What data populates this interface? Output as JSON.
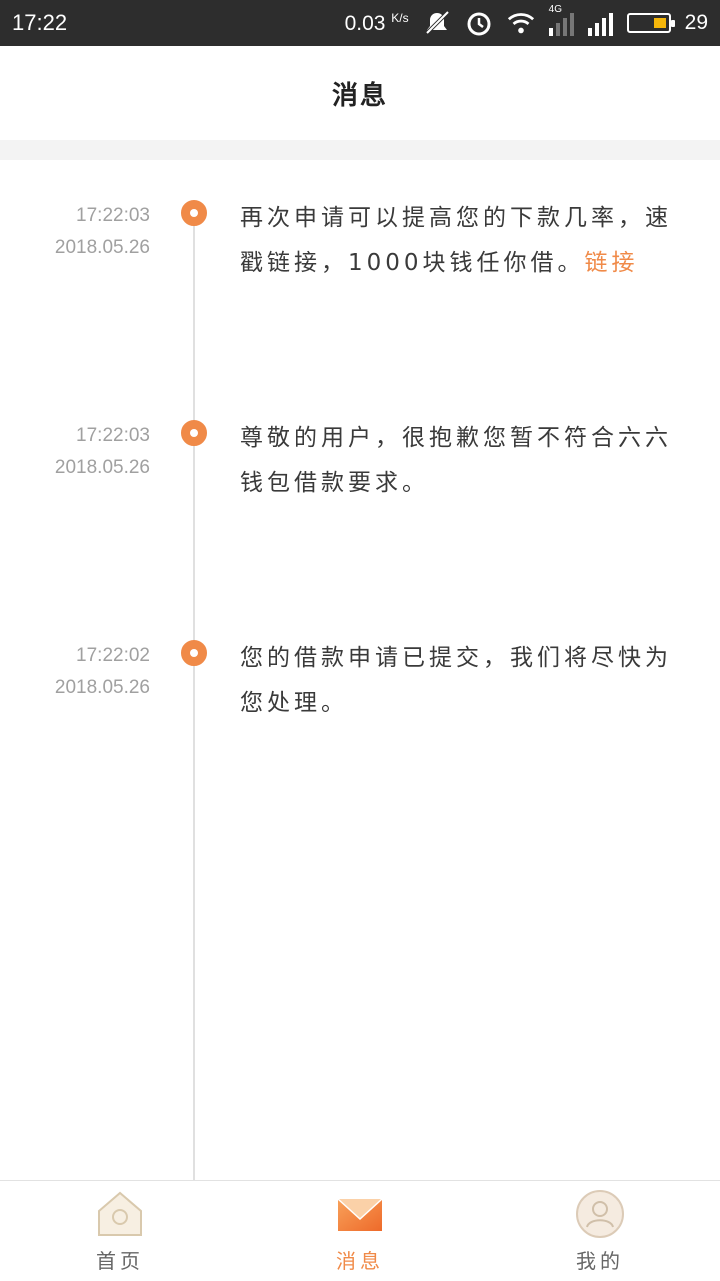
{
  "status_bar": {
    "time": "17:22",
    "net_speed": "0.03",
    "net_speed_unit": "K/s",
    "network_type": "4G",
    "battery": "29",
    "icons": [
      "mute-icon",
      "alarm-icon",
      "wifi-icon",
      "signal-4g-icon",
      "signal-icon",
      "battery-icon"
    ]
  },
  "header": {
    "title": "消息"
  },
  "messages": [
    {
      "time": "17:22:03",
      "date": "2018.05.26",
      "text": "再次申请可以提高您的下款几率，速戳链接，1000块钱任你借。",
      "link": "链接"
    },
    {
      "time": "17:22:03",
      "date": "2018.05.26",
      "text": "尊敬的用户，很抱歉您暂不符合六六钱包借款要求。"
    },
    {
      "time": "17:22:02",
      "date": "2018.05.26",
      "text": "您的借款申请已提交，我们将尽快为您处理。"
    }
  ],
  "nav": {
    "items": [
      {
        "label": "首页",
        "icon": "home-icon",
        "active": false
      },
      {
        "label": "消息",
        "icon": "mail-icon",
        "active": true
      },
      {
        "label": "我的",
        "icon": "user-icon",
        "active": false
      }
    ]
  },
  "colors": {
    "accent": "#f08a48",
    "status_bar": "#2d2d2d",
    "battery_fill": "#f5b60a"
  }
}
